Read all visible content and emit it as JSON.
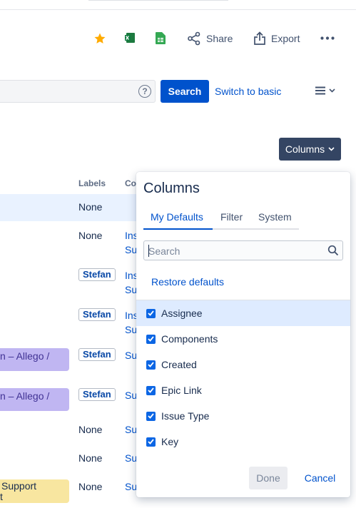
{
  "toolbar": {
    "share_label": "Share",
    "export_label": "Export",
    "colors": {
      "star": "#ffab00",
      "excel": "#1d7a3f",
      "sheets": "#34a853"
    }
  },
  "search": {
    "placeholder": "",
    "help_glyph": "?",
    "search_label": "Search",
    "switch_label": "Switch to basic"
  },
  "columns_button": {
    "label": "Columns"
  },
  "table": {
    "headers": {
      "labels": "Labels",
      "components": "Co"
    },
    "rows": [
      {
        "label_text": "None",
        "label_lozenge": "",
        "epic": "",
        "comp_line1": "",
        "comp_line2": ""
      },
      {
        "label_text": "None",
        "label_lozenge": "",
        "epic": "",
        "comp_line1": "Ins",
        "comp_line2": "Su"
      },
      {
        "label_text": "",
        "label_lozenge": "Stefan",
        "epic": "",
        "comp_line1": "Ins",
        "comp_line2": "Su"
      },
      {
        "label_text": "",
        "label_lozenge": "Stefan",
        "epic": "",
        "comp_line1": "Ins",
        "comp_line2": "Su"
      },
      {
        "label_text": "",
        "label_lozenge": "Stefan",
        "epic": "n – Allego /",
        "comp_line1": "Su",
        "comp_line2": ""
      },
      {
        "label_text": "",
        "label_lozenge": "Stefan",
        "epic": "n – Allego /",
        "comp_line1": "Su",
        "comp_line2": ""
      },
      {
        "label_text": "None",
        "label_lozenge": "",
        "epic": "",
        "comp_line1": "Su",
        "comp_line2": ""
      },
      {
        "label_text": "None",
        "label_lozenge": "",
        "epic": "",
        "comp_line1": "Su",
        "comp_line2": ""
      },
      {
        "label_text": "None",
        "label_lozenge": "",
        "epic_line1": "Support",
        "epic_line2": "t",
        "comp_line1": "Su",
        "comp_line2": ""
      }
    ]
  },
  "panel": {
    "title": "Columns",
    "tabs": [
      "My Defaults",
      "Filter",
      "System"
    ],
    "active_tab": "My Defaults",
    "search_placeholder": "Search",
    "restore_label": "Restore defaults",
    "options": [
      {
        "label": "Assignee",
        "checked": true
      },
      {
        "label": "Components",
        "checked": true
      },
      {
        "label": "Created",
        "checked": true
      },
      {
        "label": "Epic Link",
        "checked": true
      },
      {
        "label": "Issue Type",
        "checked": true
      },
      {
        "label": "Key",
        "checked": true
      }
    ],
    "done_label": "Done",
    "cancel_label": "Cancel"
  }
}
